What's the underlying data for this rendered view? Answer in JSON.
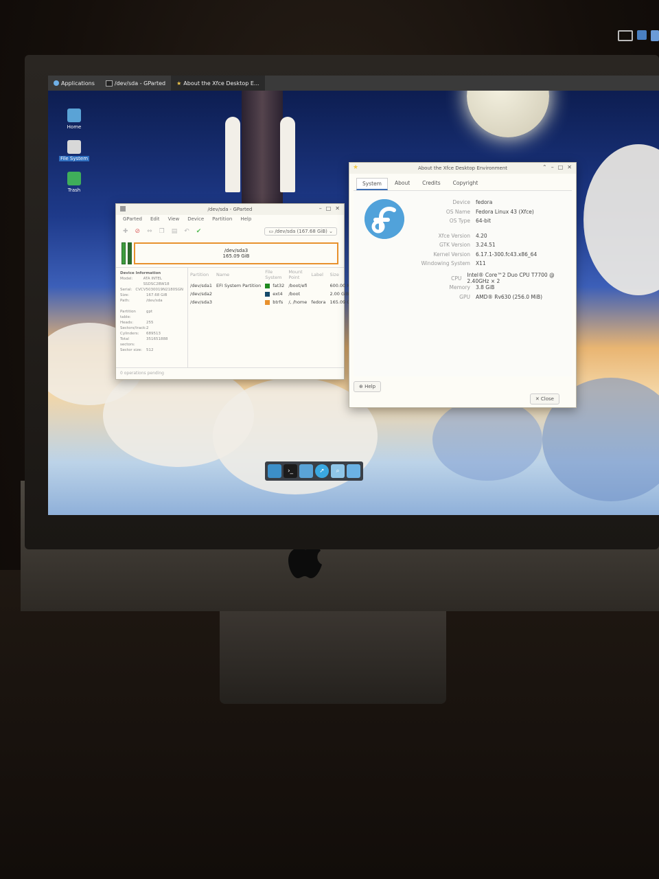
{
  "panel": {
    "applications": "Applications",
    "tasks": [
      {
        "label": "/dev/sda - GParted"
      },
      {
        "label": "About the Xfce Desktop E..."
      }
    ]
  },
  "desktop_icons": [
    {
      "label": "Home"
    },
    {
      "label": "File System"
    },
    {
      "label": "Trash"
    }
  ],
  "gparted": {
    "title": "/dev/sda - GParted",
    "menu": [
      "GParted",
      "Edit",
      "View",
      "Device",
      "Partition",
      "Help"
    ],
    "device_selector": "/dev/sda (167.68 GiB)",
    "diskbar": {
      "name": "/dev/sda3",
      "size": "165.09 GiB"
    },
    "device_info": {
      "heading": "Device Information",
      "rows": [
        {
          "k": "Model:",
          "v": "ATA INTEL SSDSC2BW18"
        },
        {
          "k": "Serial:",
          "v": "CVCV5030019N2180SGN"
        },
        {
          "k": "Size:",
          "v": "167.68 GiB"
        },
        {
          "k": "Path:",
          "v": "/dev/sda"
        }
      ],
      "rows2": [
        {
          "k": "Partition table:",
          "v": "gpt"
        },
        {
          "k": "Heads:",
          "v": "255"
        },
        {
          "k": "Sectors/track:",
          "v": "2"
        },
        {
          "k": "Cylinders:",
          "v": "689513"
        },
        {
          "k": "Total sectors:",
          "v": "351651888"
        },
        {
          "k": "Sector size:",
          "v": "512"
        }
      ]
    },
    "columns": [
      "Partition",
      "Name",
      "File System",
      "Mount Point",
      "Label",
      "Size"
    ],
    "partitions": [
      {
        "partition": "/dev/sda1",
        "name": "EFI System Partition",
        "fs": "fat32",
        "mount": "/boot/efi",
        "label": "",
        "size": "600.00 MiB",
        "color": "#1f8a1f"
      },
      {
        "partition": "/dev/sda2",
        "name": "",
        "fs": "ext4",
        "mount": "/boot",
        "label": "",
        "size": "2.00 GiB",
        "color": "#154a6a"
      },
      {
        "partition": "/dev/sda3",
        "name": "",
        "fs": "btrfs",
        "mount": "/, /home",
        "label": "fedora",
        "size": "165.09 GiB",
        "color": "#e8912d"
      }
    ],
    "status": "0 operations pending"
  },
  "about": {
    "title": "About the Xfce Desktop Environment",
    "tabs": [
      "System",
      "About",
      "Credits",
      "Copyright"
    ],
    "rows": [
      {
        "k": "Device",
        "v": "fedora"
      },
      {
        "k": "OS Name",
        "v": "Fedora Linux 43 (Xfce)"
      },
      {
        "k": "OS Type",
        "v": "64-bit"
      }
    ],
    "rows2": [
      {
        "k": "Xfce Version",
        "v": "4.20"
      },
      {
        "k": "GTK Version",
        "v": "3.24.51"
      },
      {
        "k": "Kernel Version",
        "v": "6.17.1-300.fc43.x86_64"
      },
      {
        "k": "Windowing System",
        "v": "X11"
      }
    ],
    "rows3": [
      {
        "k": "CPU",
        "v": "Intel® Core™2 Duo CPU T7700 @ 2.40GHz × 2"
      },
      {
        "k": "Memory",
        "v": "3.8 GiB"
      },
      {
        "k": "GPU",
        "v": "AMD® Rv630 (256.0 MiB)"
      }
    ],
    "help_label": "Help",
    "close_label": "Close"
  },
  "colors": {
    "accent": "#3c6eb4",
    "fedora_blue": "#51a2da",
    "orange": "#e8912d"
  }
}
